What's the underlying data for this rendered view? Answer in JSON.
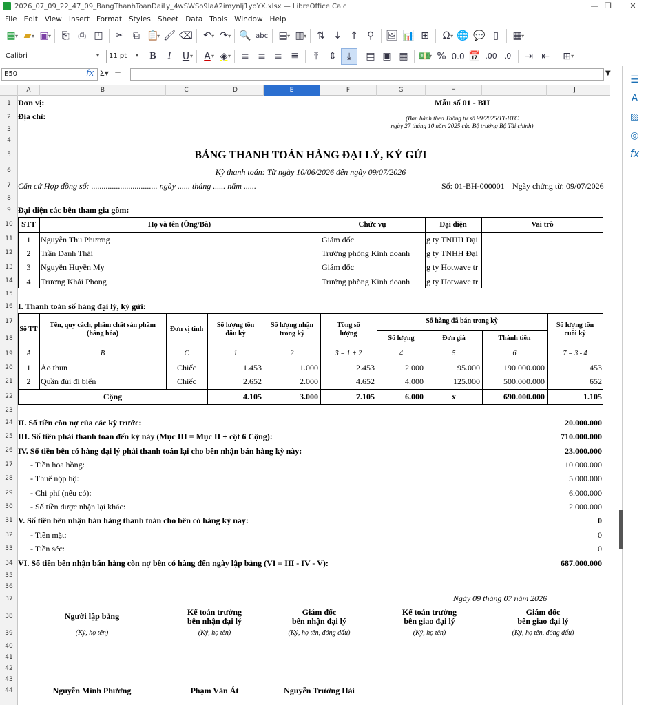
{
  "window": {
    "title": "2026_07_09_22_47_09_BangThanhToanDaiLy_4wSWSo9laA2imynlj1yoYX.xlsx — LibreOffice Calc"
  },
  "menu": [
    "File",
    "Edit",
    "View",
    "Insert",
    "Format",
    "Styles",
    "Sheet",
    "Data",
    "Tools",
    "Window",
    "Help"
  ],
  "toolbar": {
    "font_name": "Calibri",
    "font_size": "11 pt"
  },
  "formula": {
    "cell_ref": "E50",
    "value": ""
  },
  "columns": [
    "A",
    "B",
    "C",
    "D",
    "E",
    "F",
    "G",
    "H",
    "I",
    "J"
  ],
  "rows": [
    "1",
    "2",
    "3",
    "4",
    "5",
    "6",
    "7",
    "8",
    "9",
    "10",
    "11",
    "12",
    "13",
    "14",
    "15",
    "16",
    "17",
    "18",
    "19",
    "20",
    "21",
    "22",
    "23",
    "24",
    "25",
    "26",
    "27",
    "28",
    "29",
    "30",
    "31",
    "32",
    "33",
    "34",
    "35",
    "36",
    "37",
    "38",
    "39",
    "40",
    "41",
    "42",
    "43",
    "44"
  ],
  "doc": {
    "don_vi": "Đơn vị:",
    "dia_chi": "Địa chỉ:",
    "mau_so": "Mẫu số 01 - BH",
    "ban_hanh_1": "(Ban hành theo Thông tư số 99/2025/TT-BTC",
    "ban_hanh_2": "ngày 27 tháng 10 năm 2025 của Bộ trưởng Bộ Tài chính)",
    "title": "BẢNG THANH TOÁN HÀNG ĐẠI LÝ, KÝ GỬI",
    "ky": "Kỳ thanh toán: Từ ngày 10/06/2026 đến ngày 09/07/2026",
    "can_cu": "Căn cứ Hợp đồng số: ................................ ngày ...... tháng ...... năm ......",
    "so": "Số: 01-BH-000001",
    "ngay_ct": "Ngày chứng từ: 09/07/2026",
    "dai_dien": "Đại diện các bên tham gia gồm:"
  },
  "reps": {
    "headers": [
      "STT",
      "Họ và tên (Ông/Bà)",
      "Chức vụ",
      "Đại diện",
      "Vai trò"
    ],
    "rows": [
      [
        "1",
        "Nguyễn Thu Phương",
        "Giám đốc",
        "g ty TNHH Đại"
      ],
      [
        "2",
        "Trần Danh Thái",
        "Trưởng phòng Kinh doanh",
        "g ty TNHH Đại"
      ],
      [
        "3",
        "Nguyễn Huyền My",
        "Giám đốc",
        "g ty Hotwave tr"
      ],
      [
        "4",
        "Trương Khải Phong",
        "Trưởng phòng Kinh doanh",
        "g ty Hotwave tr"
      ]
    ]
  },
  "section1": "I. Thanh toán số hàng đại lý, ký gửi:",
  "goods": {
    "h_stt": "Số TT",
    "h_name": "Tên, quy cách, phẩm chất sản phẩm (hàng hóa)",
    "h_unit": "Đơn vị tính",
    "h_open": "Số lượng tồn đầu kỳ",
    "h_recv": "Số lượng nhận trong kỳ",
    "h_total": "Tổng số lượng",
    "h_sold": "Số hàng đã bán trong kỳ",
    "h_qty": "Số lượng",
    "h_price": "Đơn giá",
    "h_amount": "Thành tiền",
    "h_close": "Số lượng tồn cuối kỳ",
    "codes": [
      "A",
      "B",
      "C",
      "1",
      "2",
      "3 = 1 + 2",
      "4",
      "5",
      "6",
      "7 = 3 - 4"
    ],
    "rows": [
      [
        "1",
        "Áo thun",
        "Chiếc",
        "1.453",
        "1.000",
        "2.453",
        "2.000",
        "95.000",
        "190.000.000",
        "453"
      ],
      [
        "2",
        "Quần đùi đi biển",
        "Chiếc",
        "2.652",
        "2.000",
        "4.652",
        "4.000",
        "125.000",
        "500.000.000",
        "652"
      ]
    ],
    "total": [
      "Cộng",
      "4.105",
      "3.000",
      "7.105",
      "6.000",
      "x",
      "690.000.000",
      "1.105"
    ]
  },
  "summary": [
    {
      "label": "II. Số tiền còn nợ của các kỳ trước:",
      "value": "20.000.000",
      "bold": true
    },
    {
      "label": "III. Số tiền phải thanh toán đến kỳ này (Mục III = Mục II + cột 6 Cộng):",
      "value": "710.000.000",
      "bold": true
    },
    {
      "label": "IV. Số tiền bên có hàng đại lý phải thanh toán lại cho bên nhận bán hàng kỳ này:",
      "value": "23.000.000",
      "bold": true
    },
    {
      "label": "- Tiền hoa hồng:",
      "value": "10.000.000",
      "bold": false
    },
    {
      "label": "- Thuế nộp hộ:",
      "value": "5.000.000",
      "bold": false
    },
    {
      "label": "- Chi phí (nếu có):",
      "value": "6.000.000",
      "bold": false
    },
    {
      "label": "- Số tiền được nhận lại khác:",
      "value": "2.000.000",
      "bold": false
    },
    {
      "label": "V. Số tiền bên nhận bán hàng thanh toán cho bên có hàng kỳ này:",
      "value": "0",
      "bold": true
    },
    {
      "label": "- Tiền mặt:",
      "value": "0",
      "bold": false
    },
    {
      "label": "- Tiền séc:",
      "value": "0",
      "bold": false
    },
    {
      "label": "VI. Số tiền bên nhận bán hàng còn nợ bên có hàng đến ngày lập bảng (VI = III - IV - V):",
      "value": "687.000.000",
      "bold": true
    }
  ],
  "sign": {
    "date": "Ngày 09 tháng 07 năm 2026",
    "titles": [
      [
        "Người lập bảng",
        ""
      ],
      [
        "Kế toán trưởng",
        "bên nhận đại lý"
      ],
      [
        "Giám đốc",
        "bên nhận đại lý"
      ],
      [
        "Kế toán trưởng",
        "bên giao đại lý"
      ],
      [
        "Giám đốc",
        "bên giao đại lý"
      ]
    ],
    "notes": [
      "(Ký, họ tên)",
      "(Ký, họ tên)",
      "(Ký, họ tên, đóng dấu)",
      "(Ký, họ tên)",
      "(Ký, họ tên, đóng dấu)"
    ],
    "names": [
      "Nguyễn Minh Phương",
      "Phạm Văn Át",
      "Nguyễn Trường Hải"
    ]
  }
}
